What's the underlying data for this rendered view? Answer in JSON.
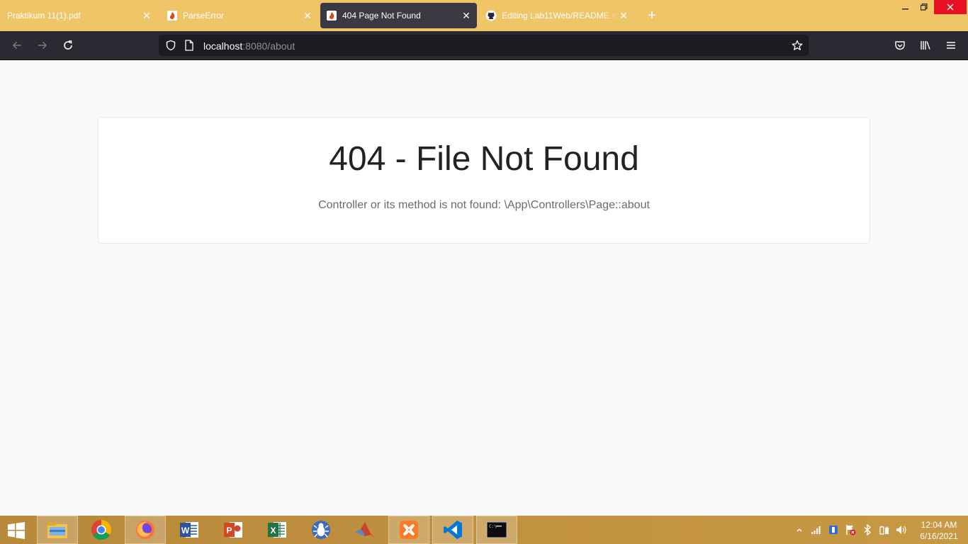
{
  "tabs": [
    {
      "title": "Praktikum 11(1).pdf",
      "icon": "none",
      "active": false
    },
    {
      "title": "ParseError",
      "icon": "codeigniter-flame-icon",
      "active": false
    },
    {
      "title": "404 Page Not Found",
      "icon": "codeigniter-flame-icon",
      "active": true
    },
    {
      "title": "Editing Lab11Web/README.md",
      "icon": "github-icon",
      "active": false
    }
  ],
  "urlbar": {
    "host": "localhost",
    "rest": ":8080/about"
  },
  "page": {
    "heading": "404 - File Not Found",
    "message": "Controller or its method is not found: \\App\\Controllers\\Page::about"
  },
  "taskbar": {
    "apps": [
      "file-explorer",
      "google-chrome",
      "firefox",
      "microsoft-word",
      "microsoft-powerpoint",
      "microsoft-excel",
      "bug-app",
      "matlab",
      "xampp",
      "visual-studio-code",
      "command-prompt"
    ],
    "active_app": "firefox"
  },
  "clock": {
    "time": "12:04 AM",
    "date": "6/16/2021"
  },
  "colors": {
    "tabstrip": "#f0c567",
    "navbar": "#2b2a33",
    "active_tab": "#3b3a42",
    "taskbar": "#c0913f",
    "close_button": "#e81123"
  }
}
